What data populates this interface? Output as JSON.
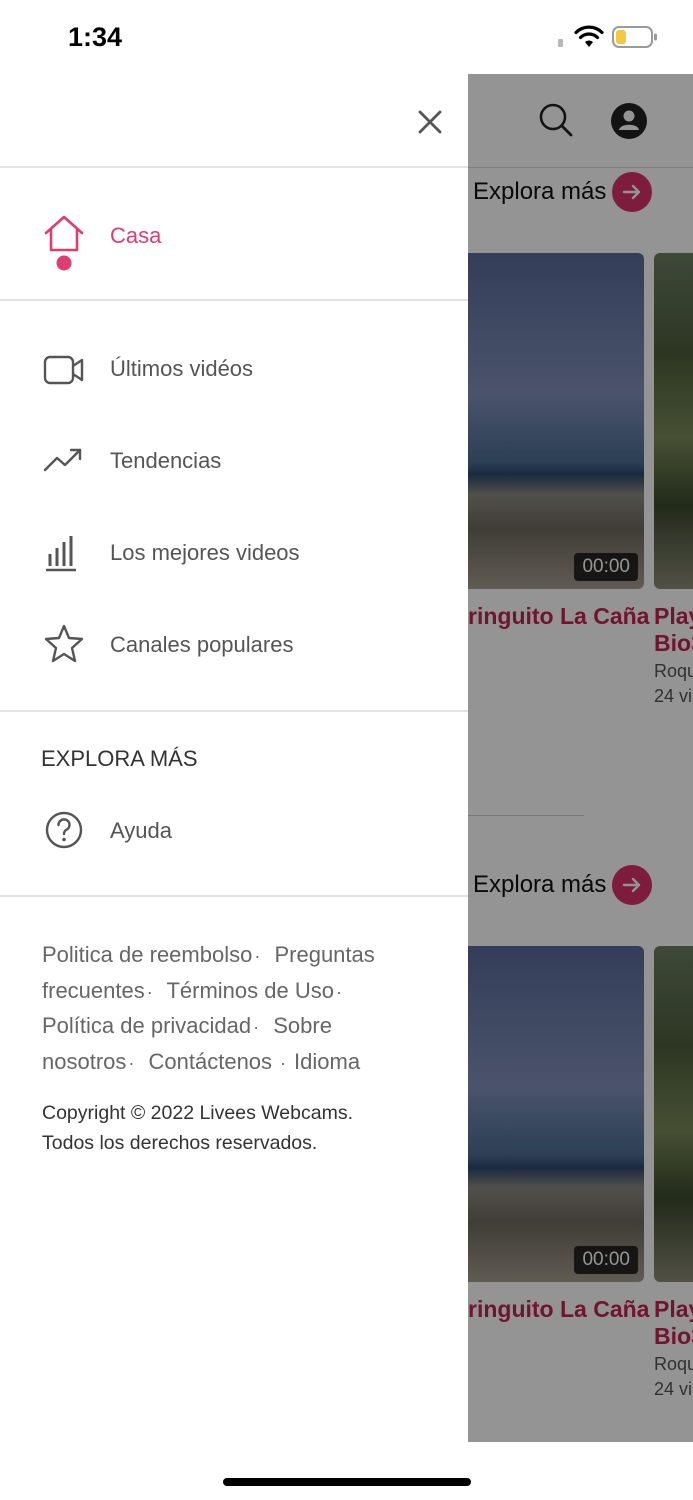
{
  "status_bar": {
    "time": "1:34"
  },
  "drawer": {
    "primary_nav": [
      {
        "label": "Casa",
        "icon": "home-icon",
        "active": true
      },
      {
        "label": "Últimos vidéos",
        "icon": "video-camera-icon"
      },
      {
        "label": "Tendencias",
        "icon": "trending-icon"
      },
      {
        "label": "Los mejores videos",
        "icon": "bar-chart-icon"
      },
      {
        "label": "Canales populares",
        "icon": "star-icon"
      }
    ],
    "explore_section": {
      "title": "EXPLORA MÁS",
      "items": [
        {
          "label": "Ayuda",
          "icon": "help-icon"
        }
      ]
    },
    "footer_links": [
      "Politica de reembolso",
      "Preguntas frecuentes",
      "Términos de Uso",
      "Política de privacidad",
      "Sobre nosotros",
      "Contáctenos",
      "Idioma"
    ],
    "copyright_line1": "Copyright © 2022 Livees Webcams.",
    "copyright_line2": "Todos los derechos reservados."
  },
  "background": {
    "explore_label": "Explora más",
    "sections": [
      {
        "explore_label": "Explora más",
        "cards": [
          {
            "title": "ringuito La Caña",
            "duration": "00:00"
          },
          {
            "title_line1": "Play",
            "title_line2": "Bio3",
            "meta_line1": "Roqu",
            "meta_line2": "24 vi"
          }
        ]
      },
      {
        "explore_label": "Explora más",
        "cards": [
          {
            "title": "ringuito La Caña",
            "duration": "00:00"
          },
          {
            "title_line1": "Play",
            "title_line2": "Bio3",
            "meta_line1": "Roqu",
            "meta_line2": "24 vi"
          }
        ]
      }
    ]
  },
  "colors": {
    "accent": "#e03c6e",
    "accent_dark": "#c22552",
    "arrow_button": "#d8316a",
    "text": "#555555"
  }
}
